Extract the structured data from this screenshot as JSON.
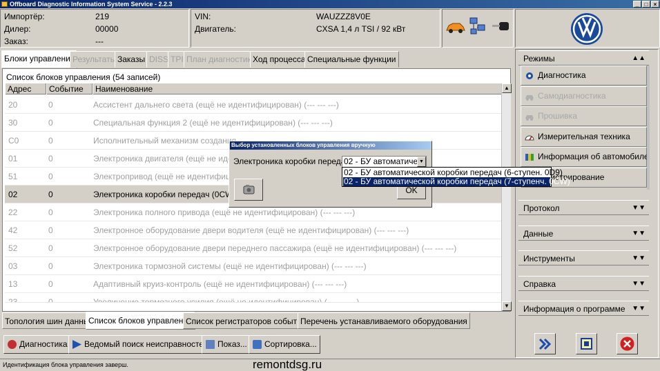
{
  "window": {
    "title": "Offboard Diagnostic Information System Service - 2.2.3",
    "min_label": "_",
    "max_label": "□",
    "close_label": "×"
  },
  "info": {
    "importer_label": "Импортёр:",
    "importer_value": "219",
    "dealer_label": "Дилер:",
    "dealer_value": "00000",
    "order_label": "Заказ:",
    "order_value": "---",
    "vin_label": "VIN:",
    "vin_value": "WAUZZZ8V0E",
    "engine_label": "Двигатель:",
    "engine_value": "CXSA 1,4 л TSI / 92 кВт"
  },
  "tabs": [
    {
      "label": "Блоки управления",
      "state": "active"
    },
    {
      "label": "Результаты",
      "state": "disabled"
    },
    {
      "label": "Заказы",
      "state": "normal"
    },
    {
      "label": "DISS",
      "state": "disabled"
    },
    {
      "label": "TPI",
      "state": "disabled"
    },
    {
      "label": "План диагностики",
      "state": "disabled"
    },
    {
      "label": "Ход процесса",
      "state": "normal"
    },
    {
      "label": "Специальные функции",
      "state": "normal"
    }
  ],
  "list": {
    "caption": "Список блоков управления (54 записей)",
    "columns": [
      "Адрес",
      "Событие",
      "Наименование"
    ],
    "rows": [
      {
        "addr": "20",
        "event": "0",
        "name": "Ассистент дальнего света (ещё не идентифицирован) (---   ---   ---)"
      },
      {
        "addr": "30",
        "event": "0",
        "name": "Специальная функция 2 (ещё не идентифицирован) (---   ---   ---)"
      },
      {
        "addr": "C0",
        "event": "0",
        "name": "Исполнительный механизм создания"
      },
      {
        "addr": "01",
        "event": "0",
        "name": "Электроника двигателя (ещё не иде"
      },
      {
        "addr": "51",
        "event": "0",
        "name": "Электропривод (ещё не идентифици"
      },
      {
        "addr": "02",
        "event": "0",
        "name": "Электроника коробки передач (0CW3",
        "selected": true
      },
      {
        "addr": "22",
        "event": "0",
        "name": "Электроника полного привода (ещё не идентифицирован) (---   ---   ---)"
      },
      {
        "addr": "42",
        "event": "0",
        "name": "Электронное оборудование двери водителя (ещё не идентифицирован) (---   ---   ---)"
      },
      {
        "addr": "52",
        "event": "0",
        "name": "Электронное оборудование двери переднего пассажира (ещё не идентифицирован) (---   ---   ---)"
      },
      {
        "addr": "03",
        "event": "0",
        "name": "Электроника тормозной системы (ещё не идентифицирован) (---   ---   ---)"
      },
      {
        "addr": "13",
        "event": "0",
        "name": "Адаптивный круиз-контроль (ещё не идентифицирован) (---   ---   ---)"
      },
      {
        "addr": "23",
        "event": "0",
        "name": "Увеличение тормозного усилия (ещё не идентифицирован) (---   ---   ---)"
      }
    ]
  },
  "bottom_tabs": [
    {
      "label": "Топология шин данных",
      "active": false
    },
    {
      "label": "Список блоков управления",
      "active": true
    },
    {
      "label": "Список регистраторов событий",
      "active": false
    },
    {
      "label": "Перечень устанавливаемого оборудования",
      "active": false
    }
  ],
  "buttons": {
    "diag": "Диагностика",
    "guided": "Ведомый поиск неисправностей",
    "show": "Показ...",
    "sort": "Сортировка..."
  },
  "status": {
    "text": "Идентификация блока управления заверш.",
    "watermark": "remontdsg.ru"
  },
  "right_panel": {
    "modes_header": "Режимы",
    "modes": [
      {
        "label": "Диагностика",
        "enabled": true,
        "icon": "stethoscope-icon"
      },
      {
        "label": "Самодиагностика",
        "enabled": false,
        "icon": "car-icon"
      },
      {
        "label": "Прошивка",
        "enabled": false,
        "icon": "car-icon"
      },
      {
        "label": "Измерительная техника",
        "enabled": true,
        "icon": "gauge-icon"
      },
      {
        "label": "Информация об автомобиле",
        "enabled": true,
        "icon": "books-icon"
      },
      {
        "label": "Регистрирование",
        "enabled": true,
        "icon": "record-icon"
      }
    ],
    "sections": [
      "Протокол",
      "Данные",
      "Инструменты",
      "Справка",
      "Информация о программе"
    ],
    "chev_up": "▲▲",
    "chev_down": "▼▼"
  },
  "dialog": {
    "title": "Выбор установленных блоков управления вручную",
    "label": "Электроника коробки передач",
    "combo_value": "02 - БУ автоматической коробки передач (7-ступенч. 0CW)",
    "options": [
      "02 - БУ автоматической коробки передач (6-ступен. 0D9)",
      "02 - БУ автоматической коробки передач (7-ступенч. 0CW)"
    ],
    "selected_option": 1,
    "ok_label": "OK"
  },
  "colors": {
    "titlebar": "#0a246a",
    "selection": "#0a246a",
    "window_bg": "#d4d0c8"
  }
}
